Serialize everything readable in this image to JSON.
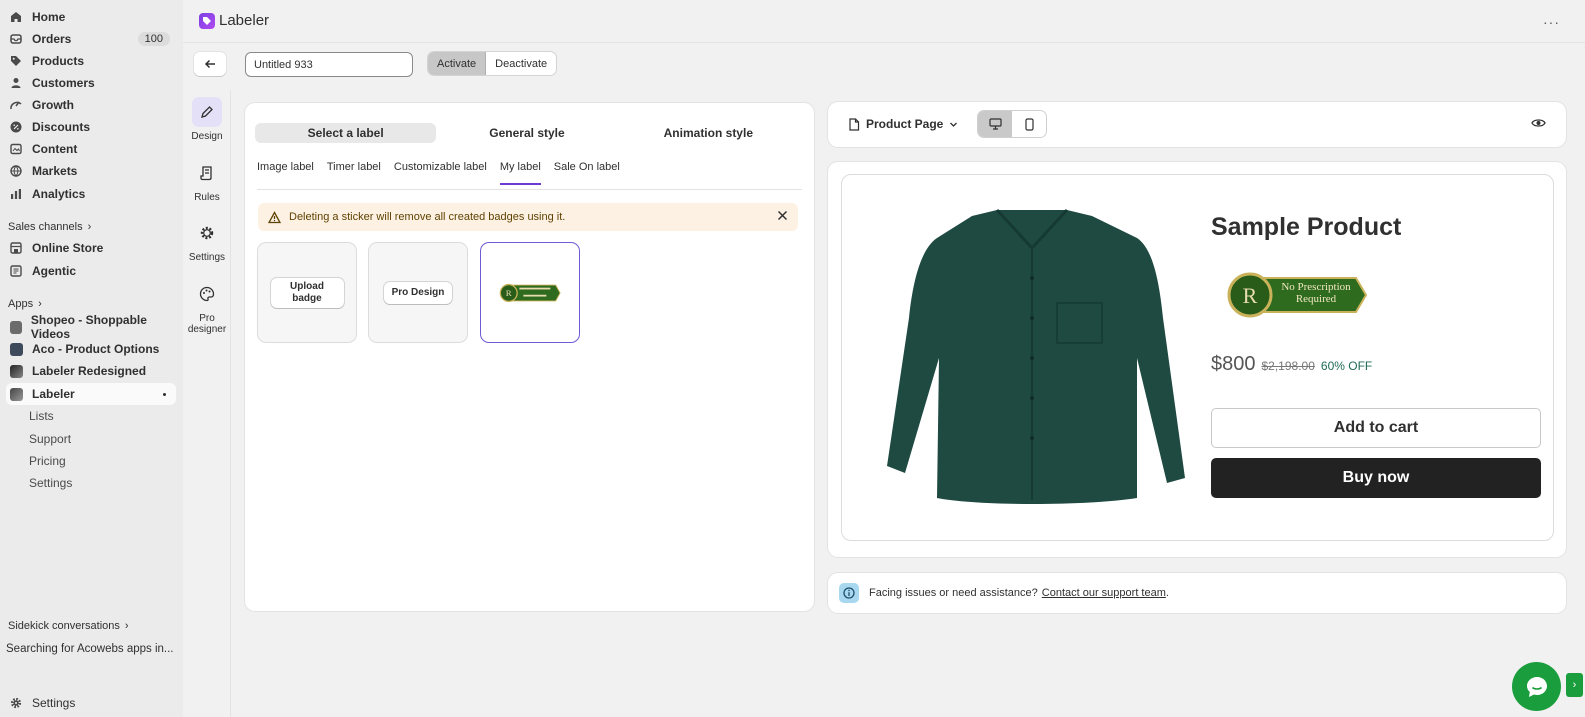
{
  "sidebar": {
    "nav": [
      {
        "label": "Home",
        "icon": "home-icon"
      },
      {
        "label": "Orders",
        "icon": "orders-icon",
        "badge": "100"
      },
      {
        "label": "Products",
        "icon": "tag-icon"
      },
      {
        "label": "Customers",
        "icon": "person-icon"
      },
      {
        "label": "Growth",
        "icon": "growth-icon"
      },
      {
        "label": "Discounts",
        "icon": "discount-icon"
      },
      {
        "label": "Content",
        "icon": "content-icon"
      },
      {
        "label": "Markets",
        "icon": "globe-icon"
      },
      {
        "label": "Analytics",
        "icon": "analytics-icon"
      }
    ],
    "sales_channels_label": "Sales channels",
    "channels": [
      {
        "label": "Online Store"
      },
      {
        "label": "Agentic"
      }
    ],
    "apps_label": "Apps",
    "apps": [
      {
        "label": "Shopeo - Shoppable Videos"
      },
      {
        "label": "Aco - Product Options"
      },
      {
        "label": "Labeler Redesigned"
      },
      {
        "label": "Labeler"
      }
    ],
    "labeler_sub": [
      "Lists",
      "Support",
      "Pricing",
      "Settings"
    ],
    "sidekick_label": "Sidekick conversations",
    "sidekick_item": "Searching for Acowebs apps in...",
    "settings_label": "Settings"
  },
  "header": {
    "title": "Labeler"
  },
  "toolbar": {
    "name_value": "Untitled 933",
    "activate": "Activate",
    "deactivate": "Deactivate"
  },
  "tools": [
    {
      "label": "Design"
    },
    {
      "label": "Rules"
    },
    {
      "label": "Settings"
    },
    {
      "label": "Pro designer"
    }
  ],
  "editor": {
    "tabs": [
      "Select a label",
      "General style",
      "Animation style"
    ],
    "subtabs": [
      "Image label",
      "Timer label",
      "Customizable label",
      "My label",
      "Sale On label"
    ],
    "warning": "Deleting a sticker will remove all created badges using it.",
    "upload_badge": "Upload badge",
    "pro_design": "Pro Design"
  },
  "preview": {
    "page_select": "Product Page",
    "product_title": "Sample Product",
    "price": "$800",
    "compare_price": "$2,198.00",
    "discount": "60% OFF",
    "add_to_cart": "Add to cart",
    "buy_now": "Buy now",
    "badge_text_1": "No Prescription",
    "badge_text_2": "Required"
  },
  "help": {
    "text": "Facing issues or need assistance?",
    "link": "Contact our support team",
    "end": "."
  },
  "colors": {
    "accent": "#6d3ad8",
    "chat": "#1a9e3d",
    "shirt": "#1e4a42"
  }
}
